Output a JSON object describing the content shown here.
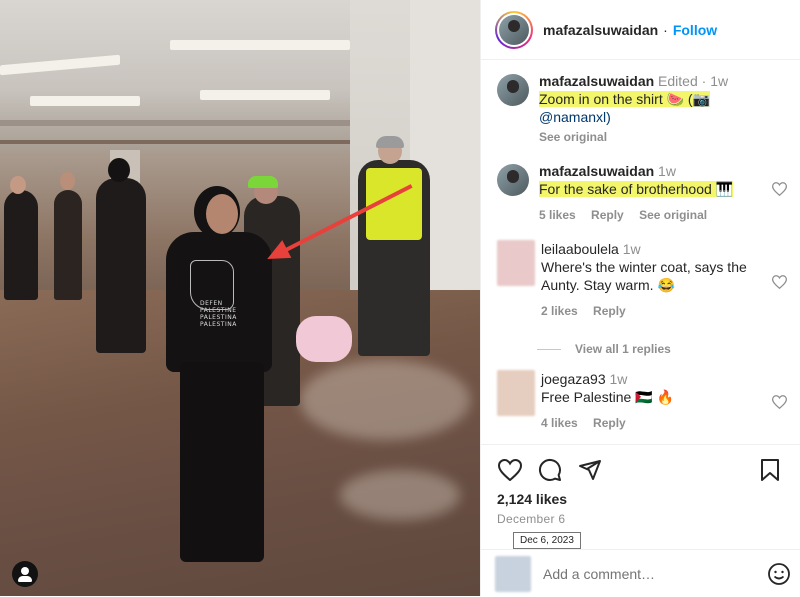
{
  "post": {
    "author": "mafazalsuwaidan",
    "separator": "·",
    "follow_label": "Follow"
  },
  "comments": [
    {
      "username": "mafazalsuwaidan",
      "edited": "Edited",
      "dot": "·",
      "time": "1w",
      "text": "Zoom in on the shirt 🍉 (📷",
      "mention": "@namanxl)",
      "see_original": "See original"
    },
    {
      "username": "mafazalsuwaidan",
      "time": "1w",
      "text": "For the sake of brotherhood 🎹",
      "likes": "5 likes",
      "reply": "Reply",
      "see_original": "See original"
    },
    {
      "username": "leilaaboulela",
      "time": "1w",
      "text": "Where's the winter coat, says the Aunty. Stay warm. 😂",
      "likes": "2 likes",
      "reply": "Reply"
    },
    {
      "username": "joegaza93",
      "time": "1w",
      "text": "Free Palestine 🇵🇸 🔥",
      "likes": "4 likes",
      "reply": "Reply"
    }
  ],
  "view_replies": "View all 1 replies",
  "likes_count": "2,124 likes",
  "post_date": "December 6",
  "date_tooltip": "Dec 6, 2023",
  "add_comment_placeholder": "Add a comment…",
  "shirt_print": [
    "DEFEN",
    "PALESTINE",
    "PALESTINA",
    "PALESTINA"
  ],
  "icons": {
    "like": "heart-icon",
    "comment": "comment-icon",
    "share": "share-icon",
    "save": "bookmark-icon",
    "emoji": "emoji-icon",
    "tag": "user-tag-icon"
  },
  "colors": {
    "accent": "#0095f6",
    "highlight": "#f3f56b",
    "arrow": "#e8403b"
  }
}
